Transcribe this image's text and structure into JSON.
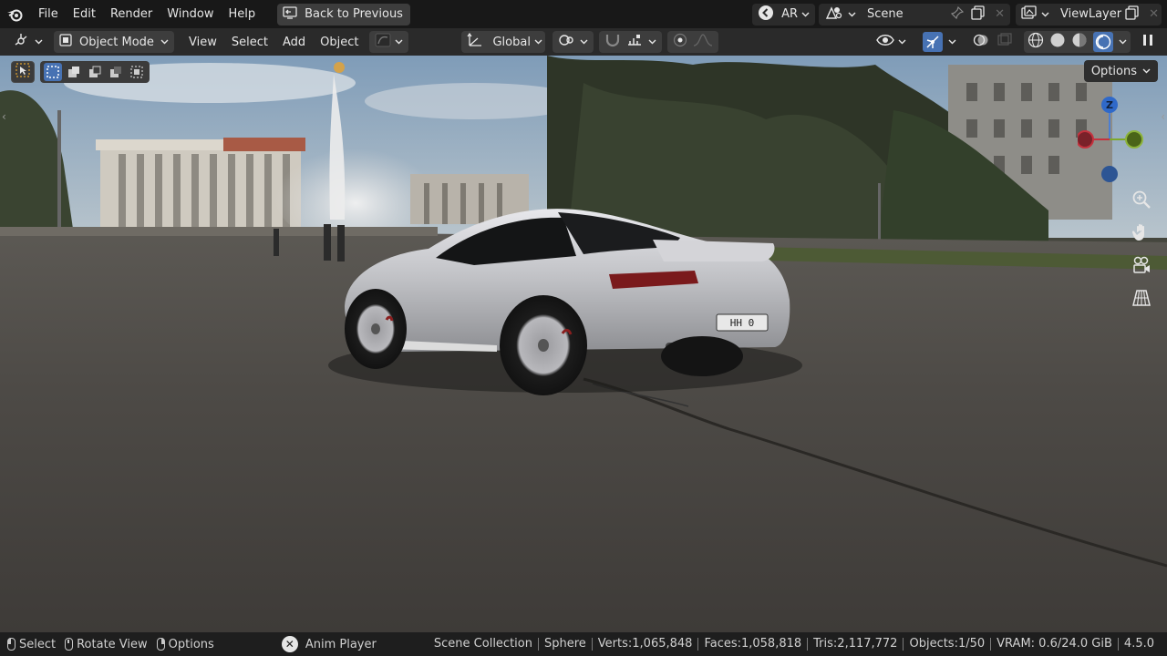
{
  "app": {
    "accent": "#4772b3"
  },
  "menu": {
    "file": "File",
    "edit": "Edit",
    "render": "Render",
    "window": "Window",
    "help": "Help",
    "back_to_previous": "Back to Previous"
  },
  "workspace": {
    "name": "AR"
  },
  "scene": {
    "name": "Scene"
  },
  "view_layer": {
    "name": "ViewLayer"
  },
  "header": {
    "mode": "Object Mode",
    "view": "View",
    "select": "Select",
    "add": "Add",
    "object": "Object",
    "transform_orientation": "Global"
  },
  "viewport": {
    "options_label": "Options",
    "gizmo": {
      "z_label": "Z"
    },
    "license_plate": "HH 0"
  },
  "statusbar": {
    "hint_select": "Select",
    "hint_rotate": "Rotate View",
    "hint_options": "Options",
    "anim_player": "Anim Player",
    "collection": "Scene Collection",
    "active_object": "Sphere",
    "verts": "Verts:1,065,848",
    "faces": "Faces:1,058,818",
    "tris": "Tris:2,117,772",
    "objects": "Objects:1/50",
    "vram": "VRAM: 0.6/24.0 GiB",
    "version": "4.5.0"
  }
}
